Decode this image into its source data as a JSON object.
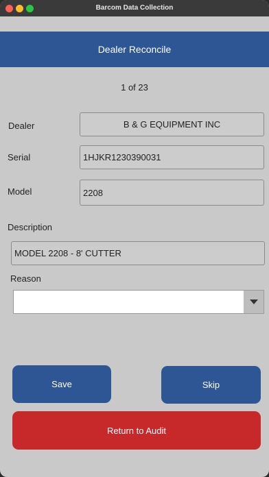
{
  "window": {
    "title": "Barcom Data Collection"
  },
  "header": {
    "title": "Dealer Reconcile"
  },
  "record": {
    "counter": "1 of 23"
  },
  "form": {
    "dealer_label": "Dealer",
    "dealer_value": "B & G EQUIPMENT INC",
    "serial_label": "Serial",
    "serial_value": "1HJKR1230390031",
    "model_label": "Model",
    "model_value": "2208",
    "description_label": "Description",
    "description_value": "MODEL 2208 - 8' CUTTER",
    "reason_label": "Reason",
    "reason_value": ""
  },
  "actions": {
    "save": "Save",
    "skip": "Skip",
    "return": "Return to Audit"
  },
  "colors": {
    "accent": "#2f5694",
    "danger": "#c7282a"
  }
}
